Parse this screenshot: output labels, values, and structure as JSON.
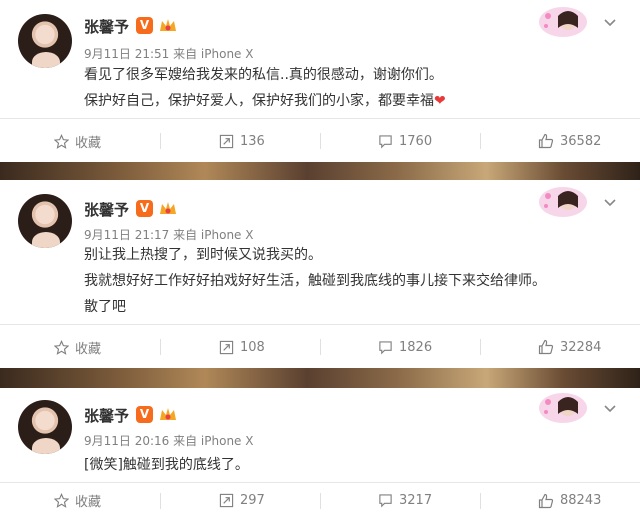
{
  "user_name": "张馨予",
  "vip_badge_label": "V",
  "posts": [
    {
      "meta": "9月11日 21:51 来自 iPhone X",
      "lines": [
        "看见了很多军嫂给我发来的私信..真的很感动，谢谢你们。",
        "保护好自己，保护好爱人，保护好我们的小家，都要幸福"
      ],
      "collect_label": "收藏",
      "repost_count": "136",
      "comment_count": "1760",
      "like_count": "36582"
    },
    {
      "meta": "9月11日 21:17 来自 iPhone X",
      "lines": [
        "别让我上热搜了，到时候又说我买的。",
        "我就想好好工作好好拍戏好好生活，触碰到我底线的事儿接下来交给律师。",
        "散了吧"
      ],
      "collect_label": "收藏",
      "repost_count": "108",
      "comment_count": "1826",
      "like_count": "32284"
    },
    {
      "meta": "9月11日 20:16 来自 iPhone X",
      "lines": [
        "[微笑]触碰到我的底线了。"
      ],
      "collect_label": "收藏",
      "repost_count": "297",
      "comment_count": "3217",
      "like_count": "88243"
    }
  ],
  "heart_glyph": "❤",
  "accent_color": "#f76b1c",
  "icons": [
    "star-icon",
    "repost-icon",
    "comment-icon",
    "like-icon",
    "chevron-down-icon",
    "vip-badge",
    "crown-badge",
    "decoration-avatar"
  ]
}
